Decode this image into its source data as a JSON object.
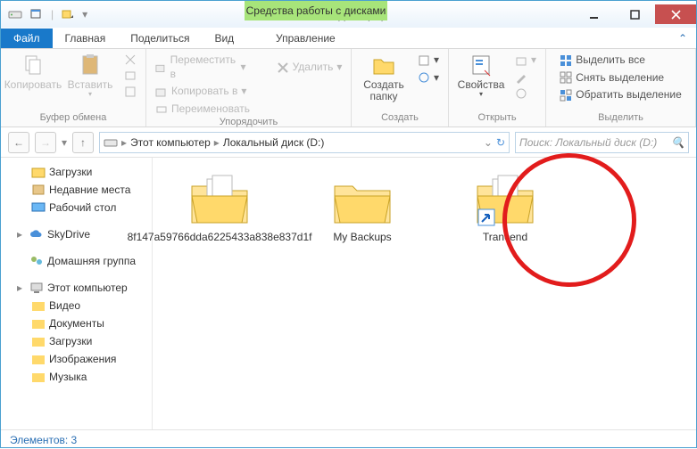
{
  "titlebar": {
    "context_tab": "Средства работы с дисками",
    "title": "Локальный диск (D:)"
  },
  "tabs": {
    "file": "Файл",
    "home": "Главная",
    "share": "Поделиться",
    "view": "Вид",
    "manage": "Управление"
  },
  "ribbon": {
    "copy": "Копировать",
    "paste": "Вставить",
    "clipboard_label": "Буфер обмена",
    "move_to": "Переместить в",
    "copy_to": "Копировать в",
    "delete": "Удалить",
    "rename": "Переименовать",
    "organize_label": "Упорядочить",
    "new_folder": "Создать папку",
    "new_label": "Создать",
    "properties": "Свойства",
    "open_label": "Открыть",
    "select_all": "Выделить все",
    "select_none": "Снять выделение",
    "invert": "Обратить выделение",
    "select_label": "Выделить"
  },
  "nav": {
    "crumb1": "Этот компьютер",
    "crumb2": "Локальный диск (D:)",
    "search_ph": "Поиск: Локальный диск (D:)"
  },
  "tree": {
    "downloads": "Загрузки",
    "recent": "Недавние места",
    "desktop": "Рабочий стол",
    "skydrive": "SkyDrive",
    "homegroup": "Домашняя группа",
    "thispc": "Этот компьютер",
    "videos": "Видео",
    "documents": "Документы",
    "downloads2": "Загрузки",
    "pictures": "Изображения",
    "music": "Музыка"
  },
  "folders": {
    "f1": "8f147a59766dda6225433a838e837d1f",
    "f2": "My Backups",
    "f3": "Trancend"
  },
  "status": {
    "count": "Элементов: 3"
  }
}
